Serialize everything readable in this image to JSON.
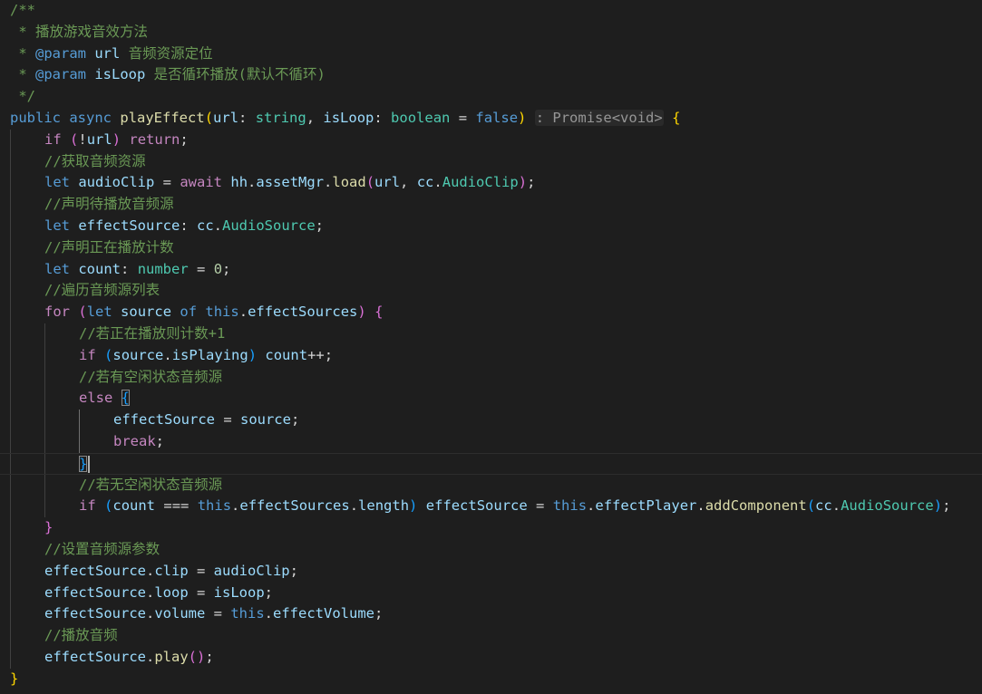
{
  "editor": {
    "language": "typescript",
    "theme_background": "#1e1e1e",
    "cursor": {
      "line": 21,
      "after": "break;"
    },
    "lines": [
      {
        "indent": 0,
        "tokens": [
          [
            "/**",
            "com"
          ]
        ]
      },
      {
        "indent": 0,
        "tokens": [
          [
            " * 播放游戏音效方法",
            "com"
          ]
        ]
      },
      {
        "indent": 0,
        "tokens": [
          [
            " * ",
            "com"
          ],
          [
            "@param",
            "doctag"
          ],
          [
            " ",
            "com"
          ],
          [
            "url",
            "docparam"
          ],
          [
            " 音频资源定位",
            "com"
          ]
        ]
      },
      {
        "indent": 0,
        "tokens": [
          [
            " * ",
            "com"
          ],
          [
            "@param",
            "doctag"
          ],
          [
            " ",
            "com"
          ],
          [
            "isLoop",
            "docparam"
          ],
          [
            " 是否循环播放(默认不循环)",
            "com"
          ]
        ]
      },
      {
        "indent": 0,
        "tokens": [
          [
            " */",
            "com"
          ]
        ]
      },
      {
        "indent": 0,
        "tokens": [
          [
            "public",
            "kw"
          ],
          [
            " ",
            "punc"
          ],
          [
            "async",
            "kw"
          ],
          [
            " ",
            "punc"
          ],
          [
            "playEffect",
            "fn"
          ],
          [
            "(",
            "b1"
          ],
          [
            "url",
            "var"
          ],
          [
            ": ",
            "punc"
          ],
          [
            "string",
            "type"
          ],
          [
            ", ",
            "punc"
          ],
          [
            "isLoop",
            "var"
          ],
          [
            ": ",
            "punc"
          ],
          [
            "boolean",
            "type"
          ],
          [
            " = ",
            "punc"
          ],
          [
            "false",
            "kw"
          ],
          [
            ")",
            "b1"
          ],
          [
            " ",
            "punc"
          ],
          [
            ": Promise<void>",
            "hint"
          ],
          [
            " ",
            "punc"
          ],
          [
            "{",
            "b1"
          ]
        ]
      },
      {
        "indent": 1,
        "tokens": [
          [
            "if",
            "ctrl"
          ],
          [
            " ",
            "punc"
          ],
          [
            "(",
            "b2"
          ],
          [
            "!",
            "punc"
          ],
          [
            "url",
            "var"
          ],
          [
            ")",
            "b2"
          ],
          [
            " ",
            "punc"
          ],
          [
            "return",
            "ctrl"
          ],
          [
            ";",
            "punc"
          ]
        ]
      },
      {
        "indent": 1,
        "tokens": [
          [
            "//获取音频资源",
            "com"
          ]
        ]
      },
      {
        "indent": 1,
        "tokens": [
          [
            "let",
            "kw"
          ],
          [
            " ",
            "punc"
          ],
          [
            "audioClip",
            "var"
          ],
          [
            " = ",
            "punc"
          ],
          [
            "await",
            "ctrl"
          ],
          [
            " ",
            "punc"
          ],
          [
            "hh",
            "var"
          ],
          [
            ".",
            "punc"
          ],
          [
            "assetMgr",
            "var"
          ],
          [
            ".",
            "punc"
          ],
          [
            "load",
            "fn"
          ],
          [
            "(",
            "b2"
          ],
          [
            "url",
            "var"
          ],
          [
            ", ",
            "punc"
          ],
          [
            "cc",
            "var"
          ],
          [
            ".",
            "punc"
          ],
          [
            "AudioClip",
            "type"
          ],
          [
            ")",
            "b2"
          ],
          [
            ";",
            "punc"
          ]
        ]
      },
      {
        "indent": 1,
        "tokens": [
          [
            "//声明待播放音频源",
            "com"
          ]
        ]
      },
      {
        "indent": 1,
        "tokens": [
          [
            "let",
            "kw"
          ],
          [
            " ",
            "punc"
          ],
          [
            "effectSource",
            "var"
          ],
          [
            ": ",
            "punc"
          ],
          [
            "cc",
            "var"
          ],
          [
            ".",
            "punc"
          ],
          [
            "AudioSource",
            "type"
          ],
          [
            ";",
            "punc"
          ]
        ]
      },
      {
        "indent": 1,
        "tokens": [
          [
            "//声明正在播放计数",
            "com"
          ]
        ]
      },
      {
        "indent": 1,
        "tokens": [
          [
            "let",
            "kw"
          ],
          [
            " ",
            "punc"
          ],
          [
            "count",
            "var"
          ],
          [
            ": ",
            "punc"
          ],
          [
            "number",
            "type"
          ],
          [
            " = ",
            "punc"
          ],
          [
            "0",
            "num"
          ],
          [
            ";",
            "punc"
          ]
        ]
      },
      {
        "indent": 1,
        "tokens": [
          [
            "//遍历音频源列表",
            "com"
          ]
        ]
      },
      {
        "indent": 1,
        "tokens": [
          [
            "for",
            "ctrl"
          ],
          [
            " ",
            "punc"
          ],
          [
            "(",
            "b2"
          ],
          [
            "let",
            "kw"
          ],
          [
            " ",
            "punc"
          ],
          [
            "source",
            "var"
          ],
          [
            " ",
            "punc"
          ],
          [
            "of",
            "kw"
          ],
          [
            " ",
            "punc"
          ],
          [
            "this",
            "kw"
          ],
          [
            ".",
            "punc"
          ],
          [
            "effectSources",
            "var"
          ],
          [
            ")",
            "b2"
          ],
          [
            " ",
            "punc"
          ],
          [
            "{",
            "b2"
          ]
        ]
      },
      {
        "indent": 2,
        "tokens": [
          [
            "//若正在播放则计数+1",
            "com"
          ]
        ]
      },
      {
        "indent": 2,
        "tokens": [
          [
            "if",
            "ctrl"
          ],
          [
            " ",
            "punc"
          ],
          [
            "(",
            "b3"
          ],
          [
            "source",
            "var"
          ],
          [
            ".",
            "punc"
          ],
          [
            "isPlaying",
            "var"
          ],
          [
            ")",
            "b3"
          ],
          [
            " ",
            "punc"
          ],
          [
            "count",
            "var"
          ],
          [
            "++;",
            "punc"
          ]
        ]
      },
      {
        "indent": 2,
        "tokens": [
          [
            "//若有空闲状态音频源",
            "com"
          ]
        ]
      },
      {
        "indent": 2,
        "tokens": [
          [
            "else",
            "ctrl"
          ],
          [
            " ",
            "punc"
          ],
          [
            "{",
            "b3box"
          ]
        ]
      },
      {
        "indent": 3,
        "tokens": [
          [
            "effectSource",
            "var"
          ],
          [
            " = ",
            "punc"
          ],
          [
            "source",
            "var"
          ],
          [
            ";",
            "punc"
          ]
        ]
      },
      {
        "indent": 3,
        "tokens": [
          [
            "break",
            "ctrl"
          ],
          [
            ";",
            "punc"
          ]
        ]
      },
      {
        "indent": 2,
        "tokens": [
          [
            "}",
            "b3box"
          ]
        ]
      },
      {
        "indent": 2,
        "tokens": [
          [
            "//若无空闲状态音频源",
            "com"
          ]
        ]
      },
      {
        "indent": 2,
        "tokens": [
          [
            "if",
            "ctrl"
          ],
          [
            " ",
            "punc"
          ],
          [
            "(",
            "b3"
          ],
          [
            "count",
            "var"
          ],
          [
            " === ",
            "punc"
          ],
          [
            "this",
            "kw"
          ],
          [
            ".",
            "punc"
          ],
          [
            "effectSources",
            "var"
          ],
          [
            ".",
            "punc"
          ],
          [
            "length",
            "var"
          ],
          [
            ")",
            "b3"
          ],
          [
            " ",
            "punc"
          ],
          [
            "effectSource",
            "var"
          ],
          [
            " = ",
            "punc"
          ],
          [
            "this",
            "kw"
          ],
          [
            ".",
            "punc"
          ],
          [
            "effectPlayer",
            "var"
          ],
          [
            ".",
            "punc"
          ],
          [
            "addComponent",
            "fn"
          ],
          [
            "(",
            "b3"
          ],
          [
            "cc",
            "var"
          ],
          [
            ".",
            "punc"
          ],
          [
            "AudioSource",
            "type"
          ],
          [
            ")",
            "b3"
          ],
          [
            ";",
            "punc"
          ]
        ]
      },
      {
        "indent": 1,
        "tokens": [
          [
            "}",
            "b2"
          ]
        ]
      },
      {
        "indent": 1,
        "tokens": [
          [
            "//设置音频源参数",
            "com"
          ]
        ]
      },
      {
        "indent": 1,
        "tokens": [
          [
            "effectSource",
            "var"
          ],
          [
            ".",
            "punc"
          ],
          [
            "clip",
            "var"
          ],
          [
            " = ",
            "punc"
          ],
          [
            "audioClip",
            "var"
          ],
          [
            ";",
            "punc"
          ]
        ]
      },
      {
        "indent": 1,
        "tokens": [
          [
            "effectSource",
            "var"
          ],
          [
            ".",
            "punc"
          ],
          [
            "loop",
            "var"
          ],
          [
            " = ",
            "punc"
          ],
          [
            "isLoop",
            "var"
          ],
          [
            ";",
            "punc"
          ]
        ]
      },
      {
        "indent": 1,
        "tokens": [
          [
            "effectSource",
            "var"
          ],
          [
            ".",
            "punc"
          ],
          [
            "volume",
            "var"
          ],
          [
            " = ",
            "punc"
          ],
          [
            "this",
            "kw"
          ],
          [
            ".",
            "punc"
          ],
          [
            "effectVolume",
            "var"
          ],
          [
            ";",
            "punc"
          ]
        ]
      },
      {
        "indent": 1,
        "tokens": [
          [
            "//播放音频",
            "com"
          ]
        ]
      },
      {
        "indent": 1,
        "tokens": [
          [
            "effectSource",
            "var"
          ],
          [
            ".",
            "punc"
          ],
          [
            "play",
            "fn"
          ],
          [
            "(",
            "b2"
          ],
          [
            ")",
            "b2"
          ],
          [
            ";",
            "punc"
          ]
        ]
      },
      {
        "indent": 0,
        "tokens": [
          [
            "}",
            "b1"
          ]
        ]
      }
    ]
  }
}
